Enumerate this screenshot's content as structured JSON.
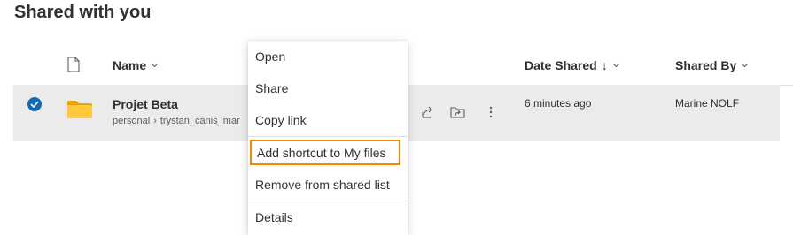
{
  "page": {
    "title": "Shared with you"
  },
  "columns": {
    "name": "Name",
    "date_shared": "Date Shared",
    "date_sort_arrow": "↓",
    "shared_by": "Shared By"
  },
  "row": {
    "name": "Projet Beta",
    "path": [
      "personal",
      "trystan_canis_mar"
    ],
    "date_shared": "6 minutes ago",
    "shared_by": "Marine NOLF",
    "selected": true
  },
  "context_menu": {
    "items": [
      "Open",
      "Share",
      "Copy link",
      "Add shortcut to My files",
      "Remove from shared list",
      "Details"
    ],
    "highlighted_item": "Add shortcut to My files"
  },
  "icons": {
    "file_type": "file-type-icon",
    "folder": "folder-icon",
    "check": "checkmark-icon",
    "share": "share-icon",
    "shortcut": "add-shortcut-icon",
    "more": "more-icon"
  },
  "colors": {
    "accent": "#0f6cbd",
    "folder": "#ffc83d",
    "row_selected_bg": "#ebebeb",
    "highlight_border": "#f08a00"
  }
}
